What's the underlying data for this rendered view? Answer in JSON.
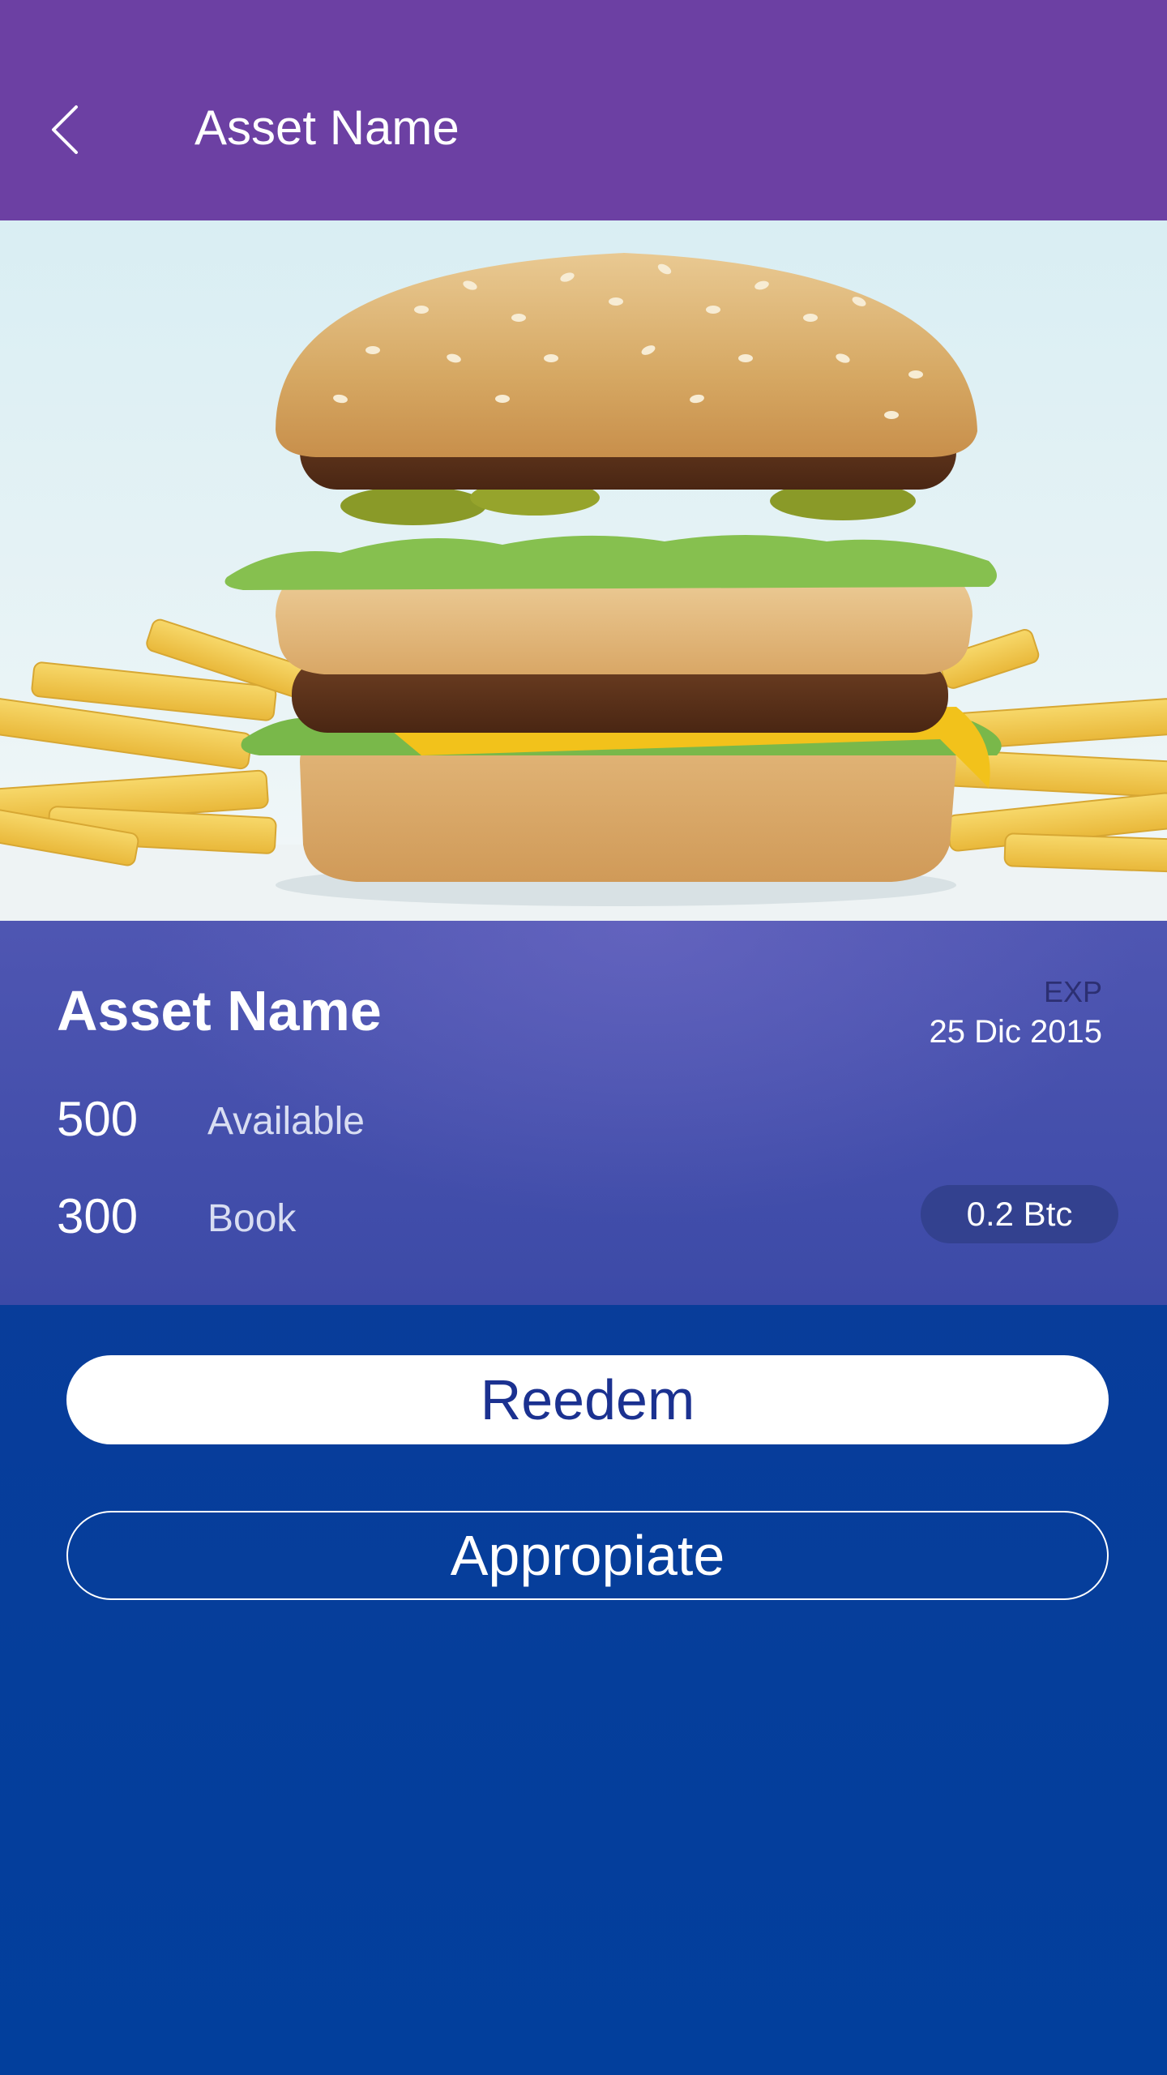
{
  "colors": {
    "header_bg": "#6c40a3",
    "card_bg": "#4f56b2",
    "page_bg": "#0a3c9a",
    "accent_text": "#1b3190"
  },
  "header": {
    "back_icon": "chevron-left-icon",
    "title": "Asset Name"
  },
  "hero": {
    "image": "burger-with-fries-photo"
  },
  "asset": {
    "name": "Asset Name",
    "exp_label": "EXP",
    "exp_date": "25 Dic 2015",
    "available_value": "500",
    "available_label": "Available",
    "book_value": "300",
    "book_label": "Book",
    "price": "0.2 Btc"
  },
  "actions": {
    "redeem_label": "Reedem",
    "appropriate_label": "Appropiate"
  }
}
